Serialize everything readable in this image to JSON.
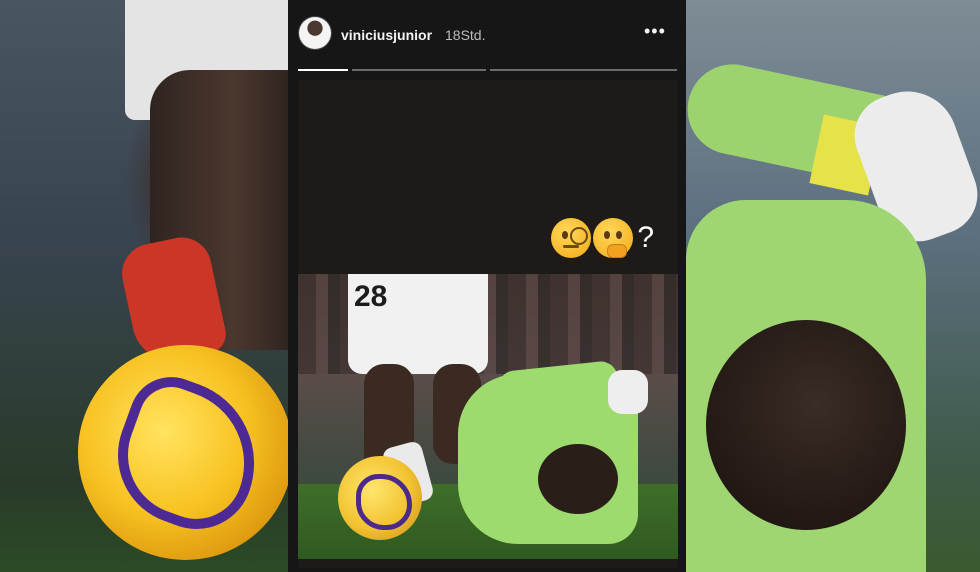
{
  "story": {
    "username": "viniciusjunior",
    "time": "18Std.",
    "more_label": "•••",
    "progress": [
      1.0,
      0.0,
      0.0
    ],
    "caption_suffix": "?"
  },
  "icons": {
    "avatar": "profile-avatar",
    "emoji_1": "face-with-monocle",
    "emoji_2": "thinking-face",
    "more": "more-options"
  },
  "photo": {
    "jersey_number": "28"
  },
  "colors": {
    "panel_bg": "#161616",
    "progress_active": "#ffffff",
    "progress_inactive": "#6b6b6b"
  }
}
